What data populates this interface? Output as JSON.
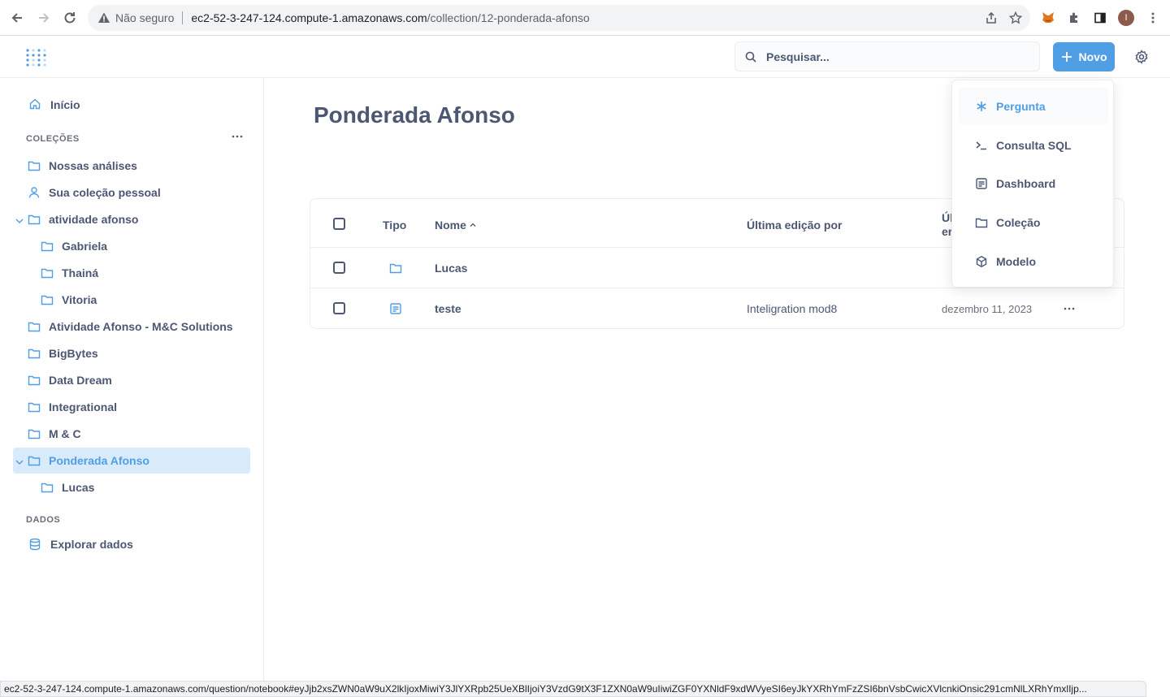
{
  "browser": {
    "security_label": "Não seguro",
    "url_host": "ec2-52-3-247-124.compute-1.amazonaws.com",
    "url_path": "/collection/12-ponderada-afonso",
    "profile_initial": "I"
  },
  "header": {
    "search_placeholder": "Pesquisar...",
    "new_button_label": "Novo"
  },
  "sidebar": {
    "home_label": "Início",
    "collections_heading": "COLEÇÕES",
    "items": [
      {
        "label": "Nossas análises"
      },
      {
        "label": "Sua coleção pessoal"
      },
      {
        "label": "atividade afonso"
      },
      {
        "label": "Gabriela"
      },
      {
        "label": "Thainá"
      },
      {
        "label": "Vitoria"
      },
      {
        "label": "Atividade Afonso - M&C Solutions"
      },
      {
        "label": "BigBytes"
      },
      {
        "label": "Data Dream"
      },
      {
        "label": "Integrational"
      },
      {
        "label": "M & C"
      },
      {
        "label": "Ponderada Afonso"
      },
      {
        "label": "Lucas"
      }
    ],
    "data_heading": "DADOS",
    "explore_label": "Explorar dados"
  },
  "main": {
    "title": "Ponderada Afonso",
    "table": {
      "headers": {
        "type": "Tipo",
        "name": "Nome",
        "last_edited_by": "Última edição por",
        "last_edited_at_1": "Úl",
        "last_edited_at_2": "er"
      },
      "rows": [
        {
          "name": "Lucas",
          "edited_by": "",
          "edited_at": ""
        },
        {
          "name": "teste",
          "edited_by": "Inteligration mod8",
          "edited_at": "dezembro 11, 2023"
        }
      ]
    }
  },
  "new_menu": {
    "items": [
      {
        "label": "Pergunta"
      },
      {
        "label": "Consulta SQL"
      },
      {
        "label": "Dashboard"
      },
      {
        "label": "Coleção"
      },
      {
        "label": "Modelo"
      }
    ]
  },
  "status_bar": {
    "text": "ec2-52-3-247-124.compute-1.amazonaws.com/question/notebook#eyJjb2xsZWN0aW9uX2lkIjoxMiwiY3JlYXRpb25UeXBlIjoiY3VzdG9tX3F1ZXN0aW9uIiwiZGF0YXNldF9xdWVyeSI6eyJkYXRhYmFzZSI6bnVsbCwicXVlcnkiOnsic291cmNlLXRhYmxlIjp..."
  },
  "colors": {
    "brand": "#509ee3",
    "text": "#4c5773"
  }
}
